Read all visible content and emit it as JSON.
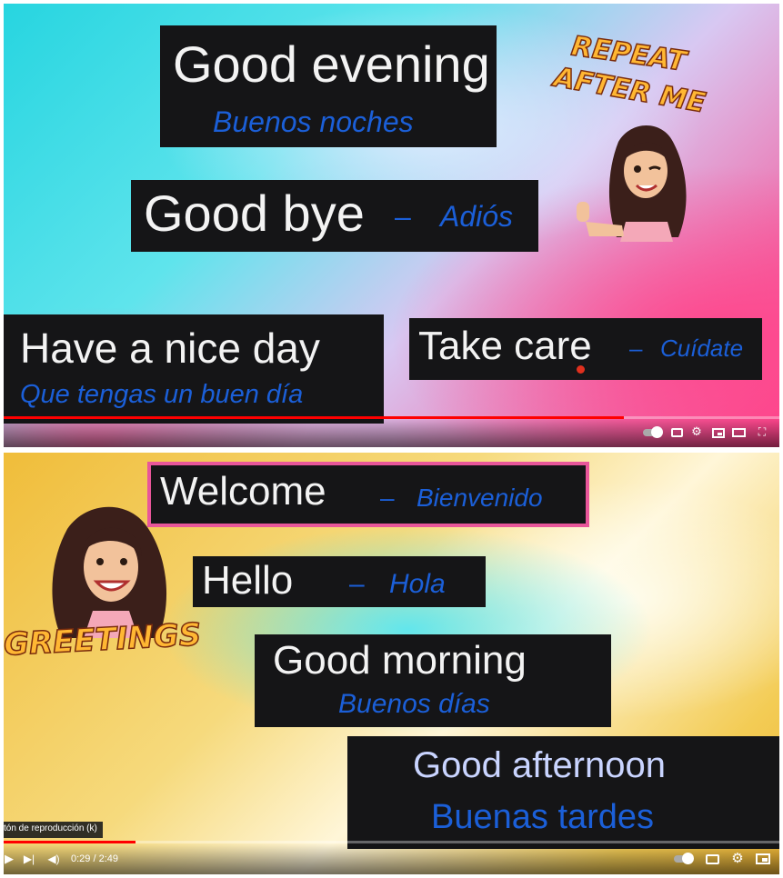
{
  "top_video": {
    "cards": {
      "good_evening": {
        "en": "Good evening",
        "es": "Buenos noches"
      },
      "good_bye": {
        "en": "Good bye",
        "dash": "–",
        "es": "Adiós"
      },
      "nice_day": {
        "en": "Have a nice day",
        "es": "Que tengas un buen día"
      },
      "take_care": {
        "en": "Take care",
        "dash": "–",
        "es": "Cuídate"
      }
    },
    "sticker_line1": "REPEAT",
    "sticker_line2": "AFTER ME",
    "progress": 0.8,
    "controls": [
      "autoplay-toggle-icon",
      "subtitles-icon",
      "settings-gear-icon",
      "miniplayer-icon",
      "theater-mode-icon",
      "fullscreen-icon"
    ]
  },
  "bottom_video": {
    "cards": {
      "welcome": {
        "en": "Welcome",
        "dash": "–",
        "es": "Bienvenido"
      },
      "hello": {
        "en": "Hello",
        "dash": "–",
        "es": "Hola"
      },
      "good_morning": {
        "en": "Good morning",
        "es": "Buenos días"
      },
      "good_afternoon": {
        "en": "Good afternoon",
        "es": "Buenas tardes"
      }
    },
    "sticker_text": "GREETINGS",
    "tooltip": "tón de reproducción (k)",
    "time": "0:29 / 2:49",
    "progress": 0.17,
    "controls": [
      "play-icon",
      "next-icon",
      "volume-icon",
      "autoplay-toggle-icon",
      "subtitles-icon",
      "settings-gear-icon",
      "miniplayer-icon"
    ]
  },
  "colors": {
    "card": "#151517",
    "english": "#f3f3f3",
    "spanish": "#1b5fd8",
    "highlight_border": "#e8569a",
    "progress": "#ff0000"
  }
}
